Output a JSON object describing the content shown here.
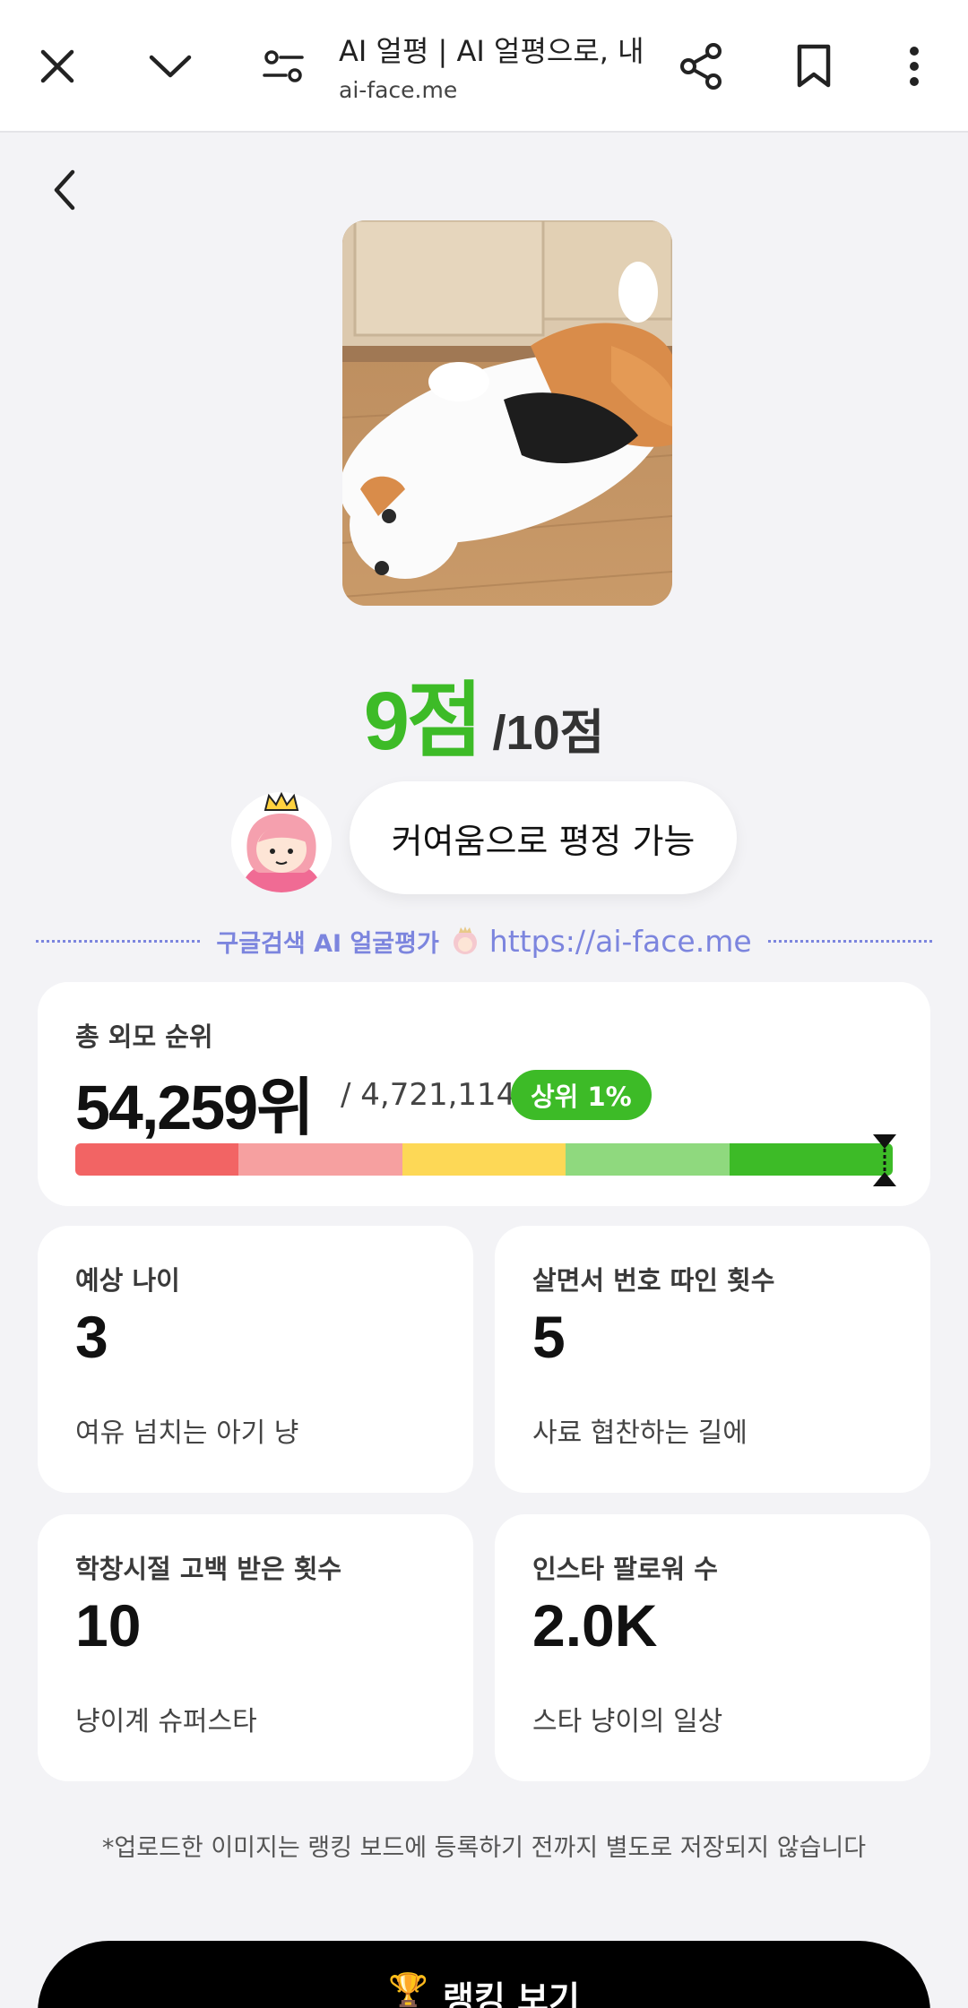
{
  "browser": {
    "title": "AI 얼평 | AI 얼평으로, 내 ...",
    "url": "ai-face.me"
  },
  "result": {
    "score": "9점",
    "score_total": "/10점",
    "comment": "커여움으로 평정 가능"
  },
  "promo": {
    "text": "구글검색 AI 얼굴평가",
    "url": "https://ai-face.me"
  },
  "ranking": {
    "label": "총 외모 순위",
    "rank": "54,259위",
    "total": "/ 4,721,114",
    "badge": "상위 1%",
    "bar_colors": [
      "#f26464",
      "#f6a0a0",
      "#fdd856",
      "#8fd97e",
      "#3dbb27"
    ],
    "percentile": 0.99
  },
  "stats": [
    {
      "label": "예상 나이",
      "value": "3",
      "desc": "여유 넘치는 아기 냥"
    },
    {
      "label": "살면서 번호 따인 횟수",
      "value": "5",
      "desc": "사료 협찬하는 길에"
    },
    {
      "label": "학창시절 고백 받은 횟수",
      "value": "10",
      "desc": "냥이계 슈퍼스타"
    },
    {
      "label": "인스타 팔로워 수",
      "value": "2.0K",
      "desc": "스타 냥이의 일상"
    }
  ],
  "disclaimer": "*업로드한 이미지는 랭킹 보드에 등록하기 전까지 별도로 저장되지 않습니다",
  "cta": {
    "label": "랭킹 보기",
    "icon": "trophy-icon"
  },
  "colors": {
    "accent_green": "#3dbb27",
    "promo_purple": "#7c85de",
    "background": "#f3f3f6"
  }
}
